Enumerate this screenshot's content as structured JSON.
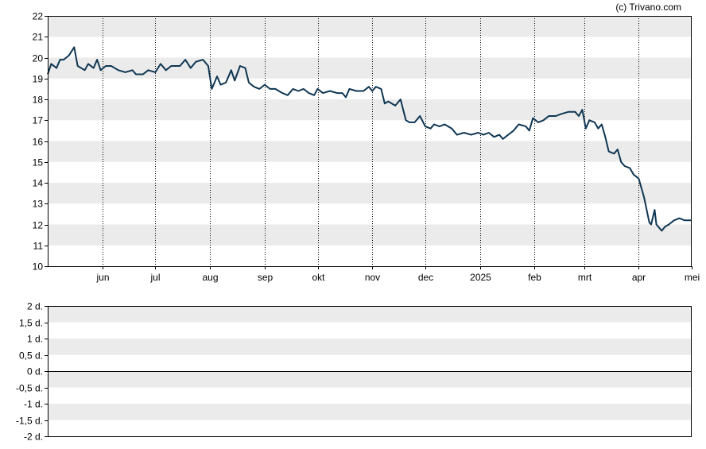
{
  "credit": "(c) Trivano.com",
  "colors": {
    "line": "#0f3652",
    "band": "#ebebeb",
    "frame": "#000000",
    "gridline": "#000000",
    "zero_line": "#000000"
  },
  "chart_data": [
    {
      "type": "line",
      "title": "",
      "xlabel": "",
      "ylabel": "",
      "ylim": [
        10,
        22
      ],
      "yticks": [
        10,
        11,
        12,
        13,
        14,
        15,
        16,
        17,
        18,
        19,
        20,
        21,
        22
      ],
      "grid": "alternating horizontal bands, dotted vertical month lines",
      "legend": "none",
      "xlim": [
        "2024-05-01",
        "2025-05-01"
      ],
      "xticks": [
        {
          "date": "2024-06-01",
          "label": "jun"
        },
        {
          "date": "2024-07-01",
          "label": "jul"
        },
        {
          "date": "2024-08-01",
          "label": "aug"
        },
        {
          "date": "2024-09-01",
          "label": "sep"
        },
        {
          "date": "2024-10-01",
          "label": "okt"
        },
        {
          "date": "2024-11-01",
          "label": "nov"
        },
        {
          "date": "2024-12-01",
          "label": "dec"
        },
        {
          "date": "2025-01-01",
          "label": "2025"
        },
        {
          "date": "2025-02-01",
          "label": "feb"
        },
        {
          "date": "2025-03-01",
          "label": "mrt"
        },
        {
          "date": "2025-04-01",
          "label": "apr"
        },
        {
          "date": "2025-05-01",
          "label": "mei"
        }
      ],
      "series": [
        {
          "points": [
            [
              "2024-05-01",
              19.2
            ],
            [
              "2024-05-03",
              19.7
            ],
            [
              "2024-05-06",
              19.5
            ],
            [
              "2024-05-08",
              19.9
            ],
            [
              "2024-05-10",
              19.9
            ],
            [
              "2024-05-13",
              20.1
            ],
            [
              "2024-05-16",
              20.5
            ],
            [
              "2024-05-18",
              19.6
            ],
            [
              "2024-05-22",
              19.4
            ],
            [
              "2024-05-24",
              19.7
            ],
            [
              "2024-05-27",
              19.5
            ],
            [
              "2024-05-29",
              19.9
            ],
            [
              "2024-05-31",
              19.4
            ],
            [
              "2024-06-03",
              19.6
            ],
            [
              "2024-06-06",
              19.6
            ],
            [
              "2024-06-10",
              19.4
            ],
            [
              "2024-06-14",
              19.3
            ],
            [
              "2024-06-18",
              19.4
            ],
            [
              "2024-06-20",
              19.2
            ],
            [
              "2024-06-24",
              19.2
            ],
            [
              "2024-06-27",
              19.4
            ],
            [
              "2024-07-01",
              19.3
            ],
            [
              "2024-07-04",
              19.7
            ],
            [
              "2024-07-07",
              19.4
            ],
            [
              "2024-07-10",
              19.6
            ],
            [
              "2024-07-15",
              19.6
            ],
            [
              "2024-07-18",
              19.9
            ],
            [
              "2024-07-21",
              19.5
            ],
            [
              "2024-07-24",
              19.8
            ],
            [
              "2024-07-28",
              19.9
            ],
            [
              "2024-07-31",
              19.6
            ],
            [
              "2024-08-02",
              18.5
            ],
            [
              "2024-08-05",
              19.1
            ],
            [
              "2024-08-07",
              18.7
            ],
            [
              "2024-08-10",
              18.8
            ],
            [
              "2024-08-13",
              19.4
            ],
            [
              "2024-08-15",
              18.9
            ],
            [
              "2024-08-18",
              19.6
            ],
            [
              "2024-08-21",
              19.5
            ],
            [
              "2024-08-23",
              18.8
            ],
            [
              "2024-08-26",
              18.6
            ],
            [
              "2024-08-29",
              18.5
            ],
            [
              "2024-09-01",
              18.7
            ],
            [
              "2024-09-04",
              18.5
            ],
            [
              "2024-09-07",
              18.5
            ],
            [
              "2024-09-11",
              18.3
            ],
            [
              "2024-09-14",
              18.2
            ],
            [
              "2024-09-17",
              18.5
            ],
            [
              "2024-09-20",
              18.4
            ],
            [
              "2024-09-23",
              18.5
            ],
            [
              "2024-09-26",
              18.3
            ],
            [
              "2024-09-29",
              18.2
            ],
            [
              "2024-10-01",
              18.5
            ],
            [
              "2024-10-04",
              18.3
            ],
            [
              "2024-10-08",
              18.4
            ],
            [
              "2024-10-12",
              18.3
            ],
            [
              "2024-10-15",
              18.3
            ],
            [
              "2024-10-17",
              18.1
            ],
            [
              "2024-10-19",
              18.5
            ],
            [
              "2024-10-23",
              18.4
            ],
            [
              "2024-10-27",
              18.4
            ],
            [
              "2024-10-30",
              18.6
            ],
            [
              "2024-11-01",
              18.4
            ],
            [
              "2024-11-03",
              18.6
            ],
            [
              "2024-11-06",
              18.5
            ],
            [
              "2024-11-08",
              17.8
            ],
            [
              "2024-11-10",
              17.9
            ],
            [
              "2024-11-14",
              17.7
            ],
            [
              "2024-11-17",
              18.0
            ],
            [
              "2024-11-20",
              17.0
            ],
            [
              "2024-11-22",
              16.9
            ],
            [
              "2024-11-25",
              16.9
            ],
            [
              "2024-11-28",
              17.2
            ],
            [
              "2024-12-01",
              16.7
            ],
            [
              "2024-12-04",
              16.6
            ],
            [
              "2024-12-06",
              16.8
            ],
            [
              "2024-12-09",
              16.7
            ],
            [
              "2024-12-12",
              16.8
            ],
            [
              "2024-12-16",
              16.6
            ],
            [
              "2024-12-19",
              16.3
            ],
            [
              "2024-12-23",
              16.4
            ],
            [
              "2024-12-27",
              16.3
            ],
            [
              "2024-12-31",
              16.4
            ],
            [
              "2025-01-03",
              16.3
            ],
            [
              "2025-01-06",
              16.4
            ],
            [
              "2025-01-09",
              16.2
            ],
            [
              "2025-01-12",
              16.3
            ],
            [
              "2025-01-14",
              16.1
            ],
            [
              "2025-01-17",
              16.3
            ],
            [
              "2025-01-20",
              16.5
            ],
            [
              "2025-01-23",
              16.8
            ],
            [
              "2025-01-27",
              16.7
            ],
            [
              "2025-01-29",
              16.5
            ],
            [
              "2025-01-31",
              17.1
            ],
            [
              "2025-02-03",
              16.9
            ],
            [
              "2025-02-06",
              17.0
            ],
            [
              "2025-02-09",
              17.2
            ],
            [
              "2025-02-13",
              17.2
            ],
            [
              "2025-02-16",
              17.3
            ],
            [
              "2025-02-20",
              17.4
            ],
            [
              "2025-02-24",
              17.4
            ],
            [
              "2025-02-26",
              17.2
            ],
            [
              "2025-02-28",
              17.5
            ],
            [
              "2025-03-02",
              16.6
            ],
            [
              "2025-03-04",
              17.0
            ],
            [
              "2025-03-07",
              16.9
            ],
            [
              "2025-03-09",
              16.6
            ],
            [
              "2025-03-11",
              16.8
            ],
            [
              "2025-03-13",
              16.2
            ],
            [
              "2025-03-15",
              15.5
            ],
            [
              "2025-03-18",
              15.4
            ],
            [
              "2025-03-20",
              15.6
            ],
            [
              "2025-03-22",
              15.0
            ],
            [
              "2025-03-24",
              14.8
            ],
            [
              "2025-03-27",
              14.7
            ],
            [
              "2025-03-29",
              14.4
            ],
            [
              "2025-04-01",
              14.2
            ],
            [
              "2025-04-04",
              13.3
            ],
            [
              "2025-04-07",
              12.1
            ],
            [
              "2025-04-08",
              12.0
            ],
            [
              "2025-04-10",
              12.7
            ],
            [
              "2025-04-11",
              12.0
            ],
            [
              "2025-04-14",
              11.7
            ],
            [
              "2025-04-16",
              11.9
            ],
            [
              "2025-04-18",
              12.0
            ],
            [
              "2025-04-21",
              12.2
            ],
            [
              "2025-04-24",
              12.3
            ],
            [
              "2025-04-27",
              12.2
            ],
            [
              "2025-05-01",
              12.2
            ]
          ]
        }
      ]
    },
    {
      "type": "line",
      "title": "",
      "xlabel": "",
      "ylabel": "",
      "ylim": [
        -2,
        2
      ],
      "yticks": [
        "2 d.",
        "1,5 d.",
        "1 d.",
        "0,5 d.",
        "0 d.",
        "-0,5 d.",
        "-1 d.",
        "-1,5 d.",
        "-2 d."
      ],
      "legend": "none",
      "series": []
    }
  ]
}
